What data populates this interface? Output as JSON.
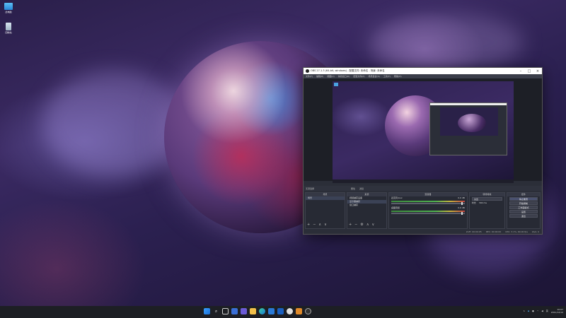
{
  "desktop": {
    "icons": [
      {
        "label": "此电脑",
        "icon": "monitor-icon"
      },
      {
        "label": "回收站",
        "icon": "recycle-bin-icon"
      }
    ]
  },
  "obs": {
    "title": "OBS 27.1.3 (64-bit, windows) - 配置文件: 未命名 - 场景: 未命名",
    "menu": [
      "文件(F)",
      "编辑(E)",
      "视图(V)",
      "停靠窗口(D)",
      "配置文件(P)",
      "场景集合(S)",
      "工具(T)",
      "帮助(H)"
    ],
    "scene_bar": {
      "label": "无源选择",
      "properties": "属性",
      "filters": "滤镜"
    },
    "docks": {
      "scenes": {
        "title": "场景",
        "items": [
          "场景"
        ]
      },
      "sources": {
        "title": "来源",
        "items": [
          "视频捕获设备",
          "显示器捕获",
          "窗口捕获"
        ]
      },
      "mixer": {
        "title": "混音器",
        "tracks": [
          {
            "name": "麦克风/Aux",
            "level": "0.0 dB"
          },
          {
            "name": "桌面音频",
            "level": "0.0 dB"
          }
        ]
      },
      "transitions": {
        "title": "转场特效",
        "type": "淡出",
        "duration_label": "时长",
        "duration": "300 ms"
      },
      "controls": {
        "title": "控件",
        "buttons": [
          "停止推流",
          "开始录制",
          "工作室模式",
          "设置",
          "退出"
        ]
      }
    },
    "status": {
      "live": "LIVE: 00:00:05",
      "rec": "REC: 00:00:00",
      "cpu": "CPU: 3.1%, 60.00 fps",
      "kbps": "kb/s: 0"
    }
  },
  "taskbar": {
    "apps": [
      "start-icon",
      "search-icon",
      "task-view-icon",
      "widgets-icon",
      "chat-icon",
      "explorer-icon",
      "edge-icon",
      "store-icon",
      "mail-icon",
      "browser-icon",
      "photos-icon",
      "obs-icon"
    ],
    "tray_lang": "英",
    "time": "10:07",
    "date": "2021/12/10"
  }
}
